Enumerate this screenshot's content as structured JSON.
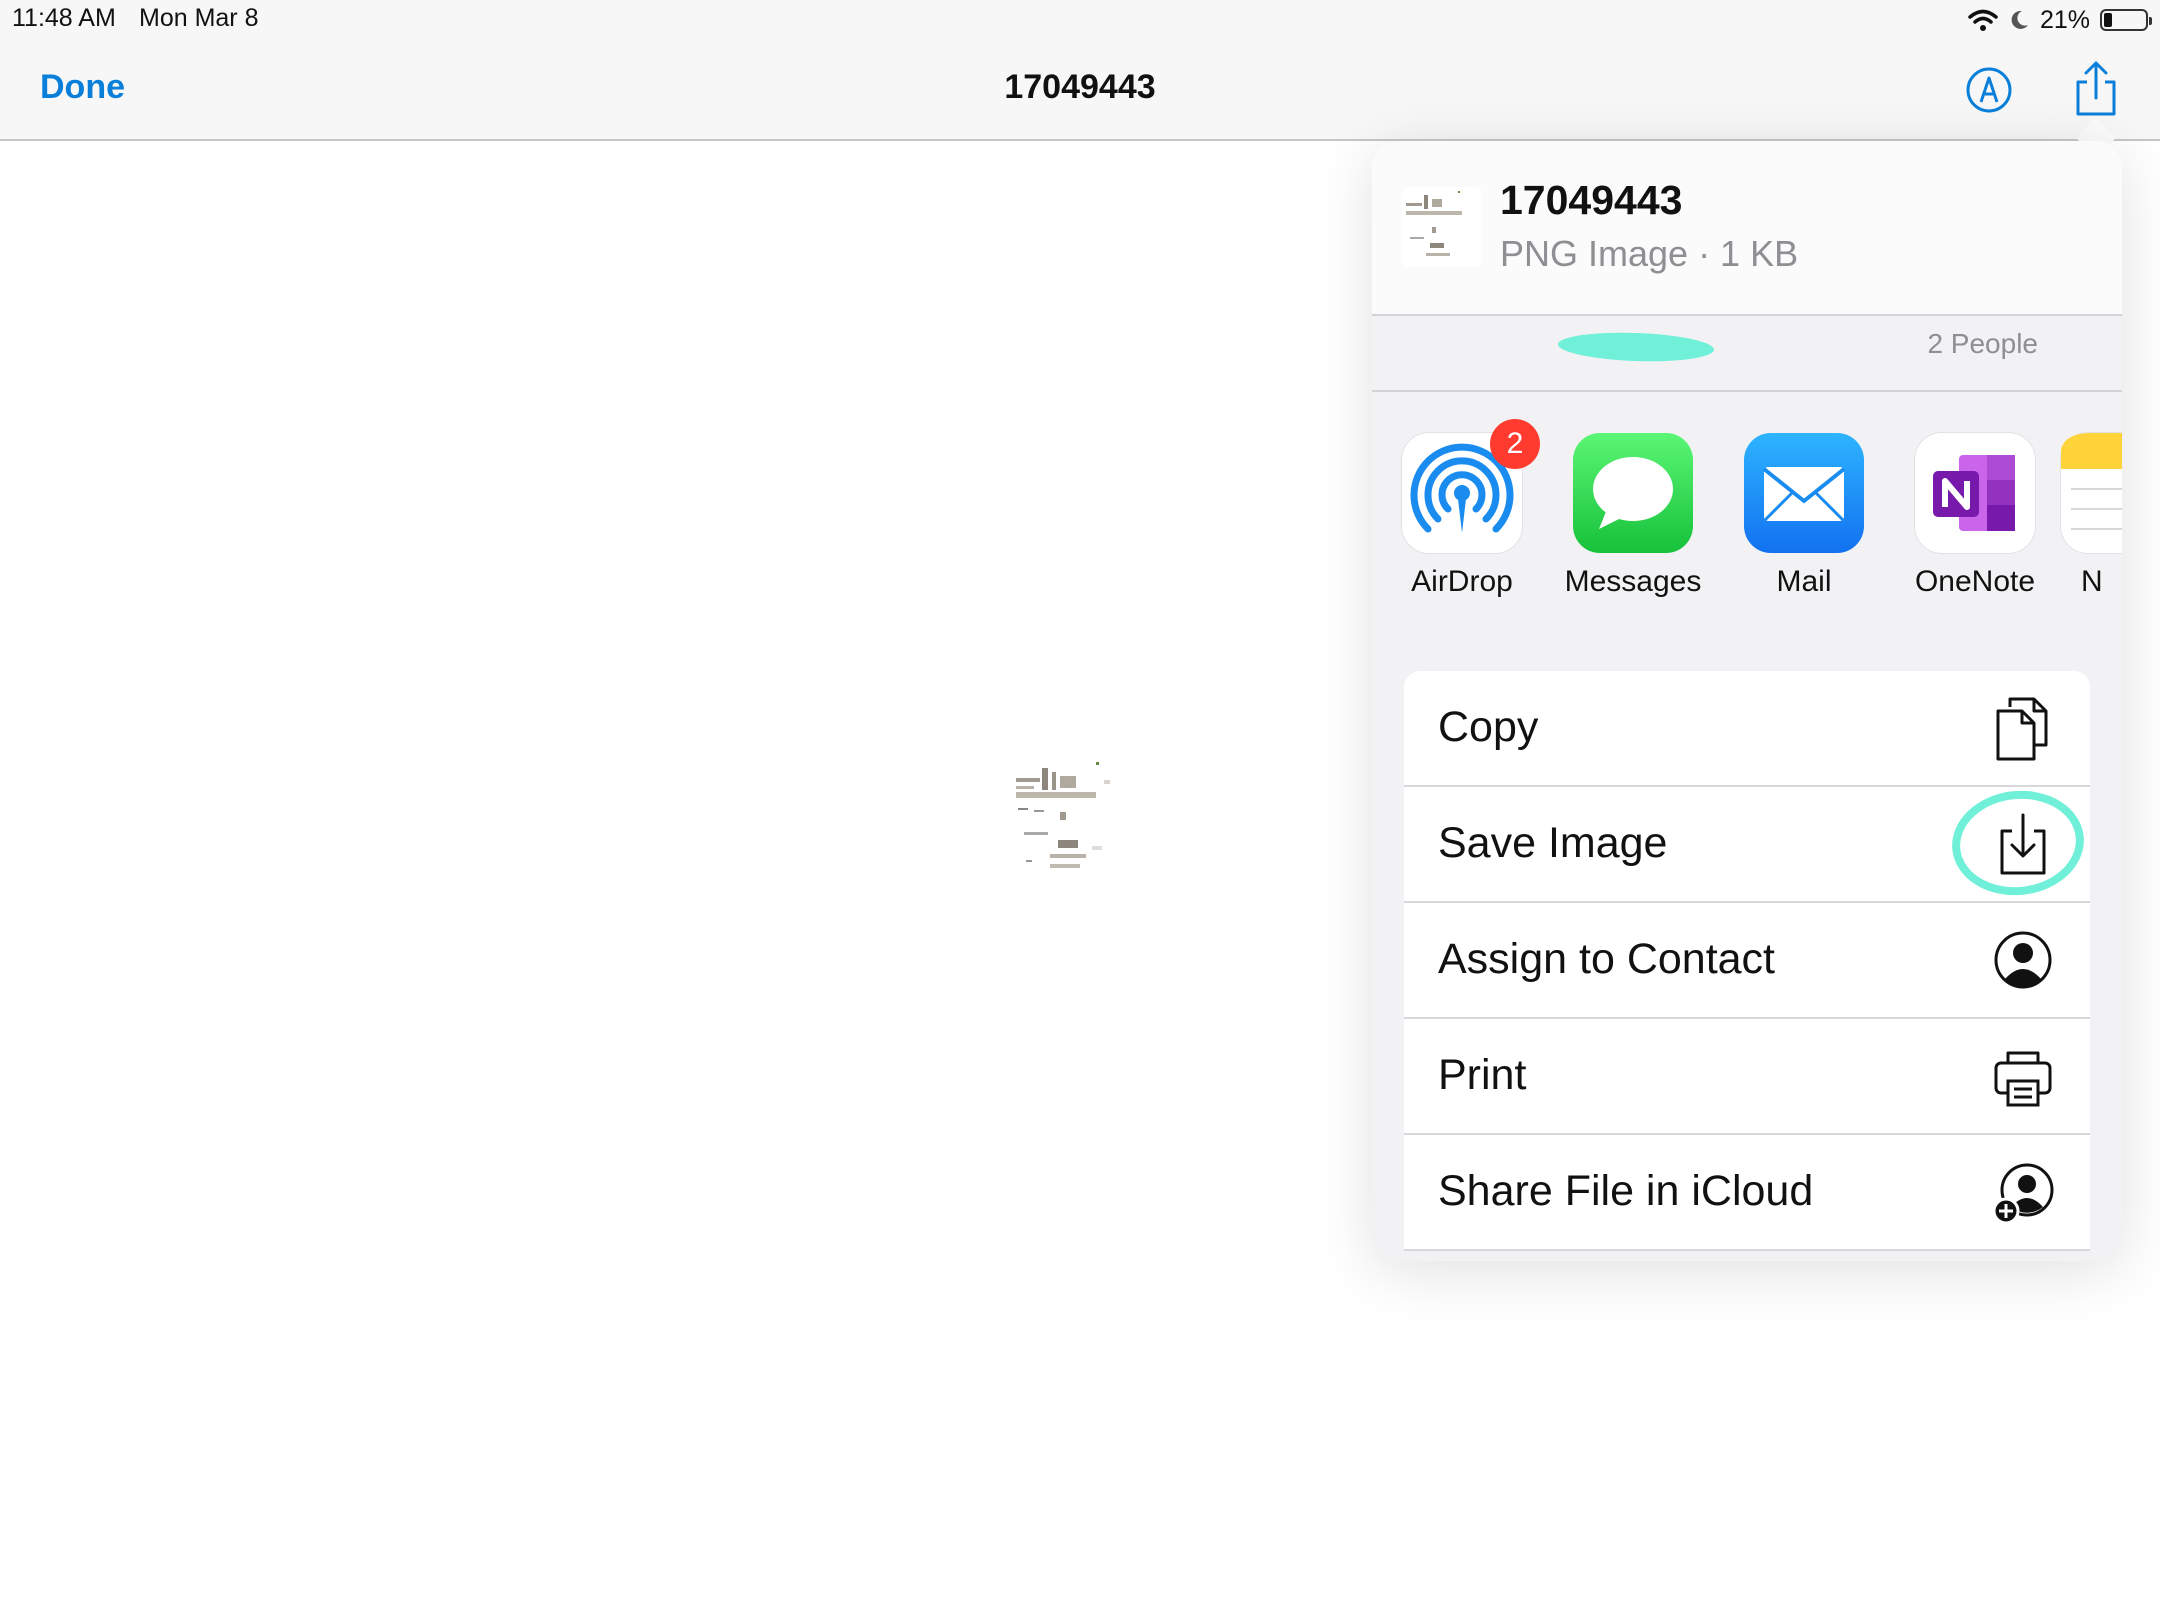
{
  "status_bar": {
    "time": "11:48 AM",
    "date": "Mon Mar 8",
    "battery": "21%",
    "battery_level": 0.21
  },
  "nav": {
    "done_label": "Done",
    "title": "17049443",
    "markup_icon": "markup-pen-icon",
    "share_icon": "share-icon"
  },
  "share_sheet": {
    "file_name": "17049443",
    "file_info": "PNG Image · 1 KB",
    "people_count": "2 People",
    "apps": [
      {
        "label": "AirDrop",
        "icon": "airdrop-icon",
        "badge": "2"
      },
      {
        "label": "Messages",
        "icon": "messages-icon"
      },
      {
        "label": "Mail",
        "icon": "mail-icon"
      },
      {
        "label": "OneNote",
        "icon": "onenote-icon"
      },
      {
        "label": "N",
        "icon": "notes-icon"
      }
    ],
    "actions": [
      {
        "label": "Copy",
        "icon": "copy-icon"
      },
      {
        "label": "Save Image",
        "icon": "save-image-icon"
      },
      {
        "label": "Assign to Contact",
        "icon": "contact-icon"
      },
      {
        "label": "Print",
        "icon": "print-icon"
      },
      {
        "label": "Share File in iCloud",
        "icon": "icloud-share-icon"
      }
    ]
  },
  "colors": {
    "accent": "#0a7fd9",
    "highlight": "#70f0d8",
    "badge": "#ff3b30"
  }
}
